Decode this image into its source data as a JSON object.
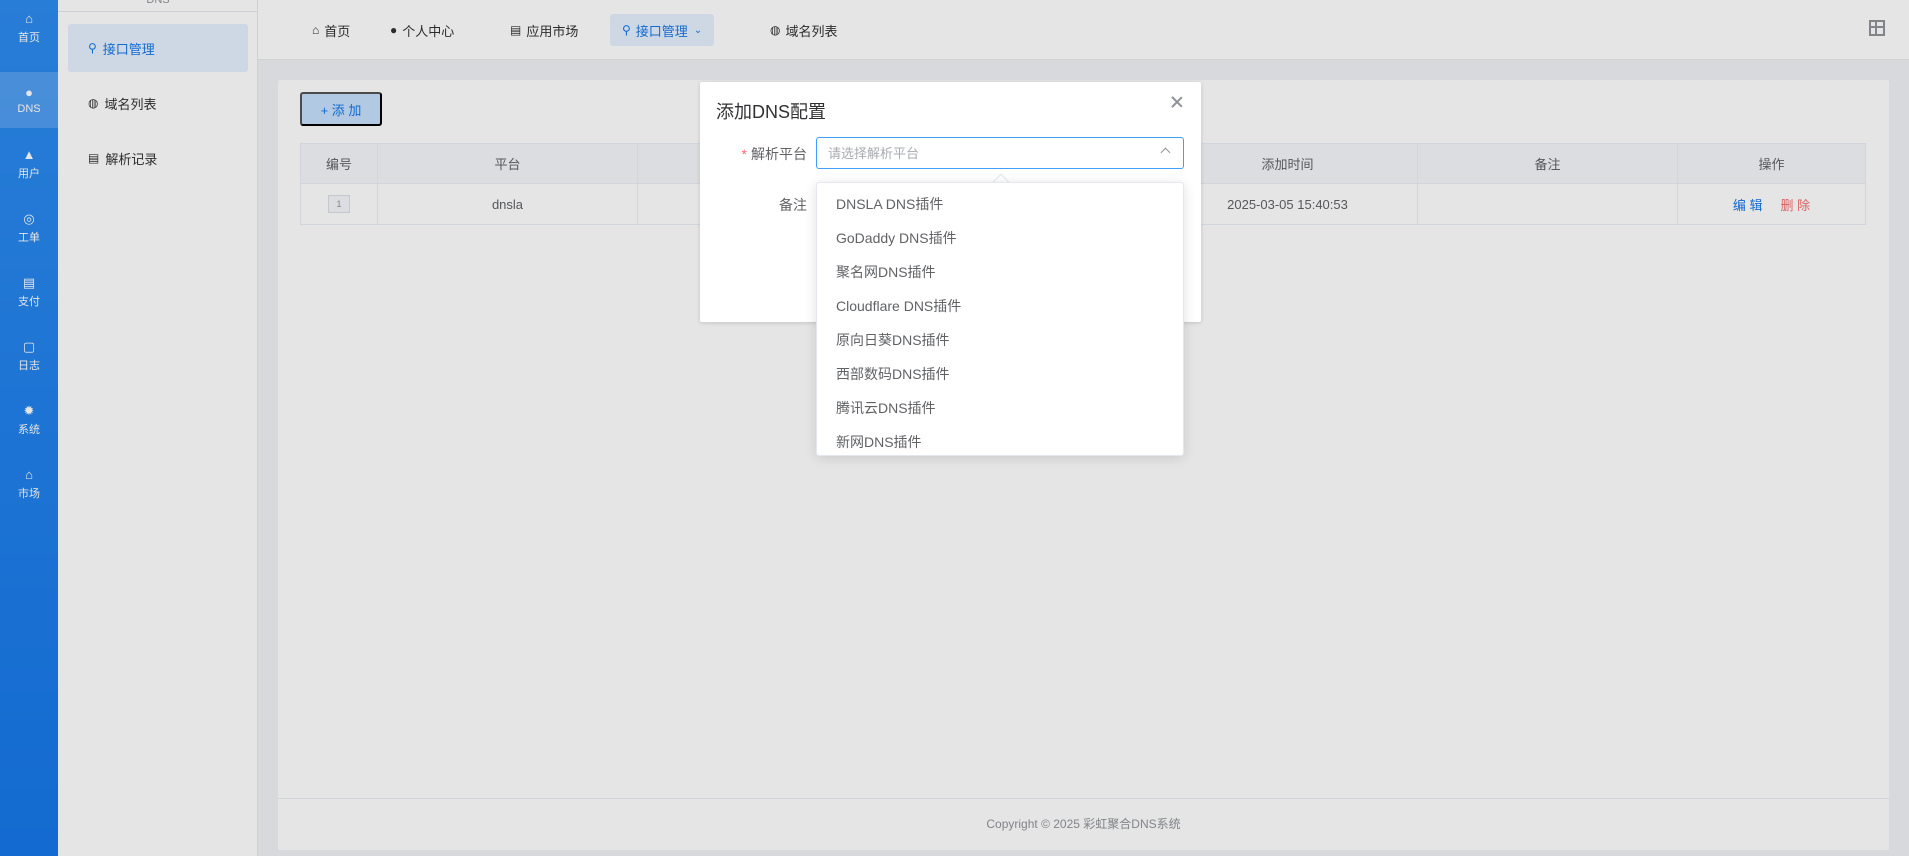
{
  "rail": {
    "items": [
      {
        "label": "首页",
        "icon": "home-icon"
      },
      {
        "label": "DNS",
        "icon": "dns-icon"
      },
      {
        "label": "用户",
        "icon": "user-icon"
      },
      {
        "label": "工单",
        "icon": "ticket-icon"
      },
      {
        "label": "支付",
        "icon": "payment-icon"
      },
      {
        "label": "日志",
        "icon": "log-icon"
      },
      {
        "label": "系统",
        "icon": "system-icon"
      },
      {
        "label": "市场",
        "icon": "market-icon"
      }
    ]
  },
  "submenu": {
    "header": "DNS",
    "items": [
      {
        "label": "接口管理",
        "icon": "api-icon"
      },
      {
        "label": "域名列表",
        "icon": "domain-list-icon"
      },
      {
        "label": "解析记录",
        "icon": "record-icon"
      }
    ]
  },
  "tabs": [
    {
      "label": "首页",
      "icon": "home-icon"
    },
    {
      "label": "个人中心",
      "icon": "profile-icon"
    },
    {
      "label": "应用市场",
      "icon": "app-market-icon"
    },
    {
      "label": "接口管理",
      "icon": "api-icon"
    },
    {
      "label": "域名列表",
      "icon": "domain-list-icon"
    }
  ],
  "content": {
    "add_button": "+ 添 加",
    "table": {
      "headers": [
        "编号",
        "平台",
        "",
        "",
        "添加时间",
        "备注",
        "操作"
      ],
      "rows": [
        {
          "id": "1",
          "platform": "dnsla",
          "added": "2025-03-05 15:40:53",
          "remark": "",
          "edit": "编 辑",
          "delete": "删 除"
        }
      ]
    },
    "footer": "Copyright © 2025 彩虹聚合DNS系统"
  },
  "dialog": {
    "title": "添加DNS配置",
    "platform_label": "解析平台",
    "platform_placeholder": "请选择解析平台",
    "remark_label": "备注"
  },
  "dropdown": {
    "options": [
      "DNSLA DNS插件",
      "GoDaddy DNS插件",
      "聚名网DNS插件",
      "Cloudflare DNS插件",
      "原向日葵DNS插件",
      "西部数码DNS插件",
      "腾讯云DNS插件",
      "新网DNS插件"
    ]
  },
  "colors": {
    "primary": "#1677e8",
    "danger": "#f56c6c",
    "rail_bg": "#1677e8"
  }
}
